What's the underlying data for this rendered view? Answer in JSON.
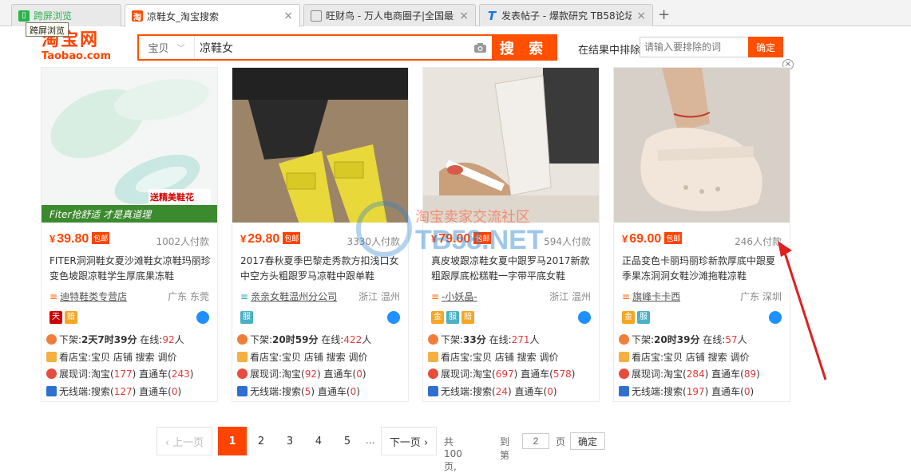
{
  "browser": {
    "tabs": [
      {
        "title": "跨屏浏览",
        "icon": "phone-icon",
        "icon_color": "#2bb24c"
      },
      {
        "title": "凉鞋女_淘宝搜索",
        "icon": "taobao-icon",
        "icon_color": "#ff5000",
        "close": "×"
      },
      {
        "title": "旺财鸟 - 万人电商圈子|全国最大",
        "icon": "document-icon",
        "icon_color": "#888888",
        "close": "×"
      },
      {
        "title": "发表帖子 - 爆款研究 TB58论坛",
        "icon": "t-icon",
        "icon_color": "#1a73e8",
        "close": "×"
      }
    ],
    "new_tab": "+",
    "tooltip": "跨屏浏览"
  },
  "header": {
    "logo_cn": "淘宝网",
    "logo_en": "Taobao.com",
    "search_type": "宝贝",
    "search_value": "凉鞋女",
    "search_button": "搜 索",
    "exclude_label": "在结果中排除",
    "exclude_placeholder": "请输入要排除的词",
    "exclude_button": "确定",
    "close": "×"
  },
  "products": [
    {
      "price": "39.80",
      "currency": "¥",
      "baoyou": "包邮",
      "sales": "1002人付款",
      "title": "FITER洞洞鞋女夏沙滩鞋女凉鞋玛丽珍变色坡跟凉鞋学生厚底果冻鞋",
      "shop": "迪特鞋类专营店",
      "location": "广东 东莞",
      "image_caption_top": "送精美鞋花",
      "image_caption_bottom": "Fiter抢舒适 才是真道理",
      "badges": [
        {
          "text": "天",
          "color": "#cc0000"
        },
        {
          "text": "赔",
          "color": "#f5a623"
        }
      ],
      "offline": "下架:",
      "offline_time": "2天7时39分",
      "online_label": "在线:",
      "online": "92",
      "online_unit": "人",
      "store_tools": "看店宝:宝贝 店铺 搜索 调价",
      "show_label": "展现词:淘宝(",
      "show_count": "177",
      "show_mid": ") 直通车(",
      "show_ztc": "243",
      "show_end": ")",
      "wireless_label": "无线端:搜索(",
      "wireless_count": "127",
      "wireless_mid": ") 直通车(",
      "wireless_ztc": "0",
      "wireless_end": ")"
    },
    {
      "price": "29.80",
      "currency": "¥",
      "baoyou": "包邮",
      "sales": "3330人付款",
      "title": "2017春秋夏季巴黎走秀款方扣浅口女中空方头粗跟罗马凉鞋中跟单鞋",
      "shop": "亲亲女鞋温州分公司",
      "location": "浙江 温州",
      "badges": [
        {
          "text": "服",
          "color": "#4ab0c5"
        }
      ],
      "offline": "下架:",
      "offline_time": "20时59分",
      "online_label": "在线:",
      "online": "422",
      "online_unit": "人",
      "store_tools": "看店宝:宝贝 店铺 搜索 调价",
      "show_label": "展现词:淘宝(",
      "show_count": "92",
      "show_mid": ") 直通车(",
      "show_ztc": "0",
      "show_end": ")",
      "wireless_label": "无线端:搜索(",
      "wireless_count": "5",
      "wireless_mid": ") 直通车(",
      "wireless_ztc": "0",
      "wireless_end": ")"
    },
    {
      "price": "79.00",
      "currency": "¥",
      "baoyou": "包邮",
      "sales": "594人付款",
      "title": "真皮坡跟凉鞋女夏中跟罗马2017新款粗跟厚底松糕鞋一字带平底女鞋",
      "shop": "-小妖晶-",
      "location": "浙江 温州",
      "badges": [
        {
          "text": "金",
          "color": "#f5a623"
        },
        {
          "text": "服",
          "color": "#4ab0c5"
        },
        {
          "text": "赔",
          "color": "#f5a623"
        }
      ],
      "offline": "下架:",
      "offline_time": "33分",
      "online_label": "在线:",
      "online": "271",
      "online_unit": "人",
      "store_tools": "看店宝:宝贝 店铺 搜索 调价",
      "show_label": "展现词:淘宝(",
      "show_count": "697",
      "show_mid": ") 直通车(",
      "show_ztc": "578",
      "show_end": ")",
      "wireless_label": "无线端:搜索(",
      "wireless_count": "24",
      "wireless_mid": ") 直通车(",
      "wireless_ztc": "0",
      "wireless_end": ")"
    },
    {
      "price": "69.00",
      "currency": "¥",
      "baoyou": "包邮",
      "sales": "246人付款",
      "title": "正品变色卡丽玛丽珍新款厚底中跟夏季果冻洞洞女鞋沙滩拖鞋凉鞋",
      "shop": "旗峰卡卡西",
      "location": "广东 深圳",
      "badges": [
        {
          "text": "金",
          "color": "#f5a623"
        },
        {
          "text": "服",
          "color": "#4ab0c5"
        }
      ],
      "offline": "下架:",
      "offline_time": "20时39分",
      "online_label": "在线:",
      "online": "57",
      "online_unit": "人",
      "store_tools": "看店宝:宝贝 店铺 搜索 调价",
      "show_label": "展现词:淘宝(",
      "show_count": "284",
      "show_mid": ") 直通车(",
      "show_ztc": "89",
      "show_end": ")",
      "wireless_label": "无线端:搜索(",
      "wireless_count": "197",
      "wireless_mid": ") 直通车(",
      "wireless_ztc": "0",
      "wireless_end": ")"
    }
  ],
  "watermark": {
    "cn": "淘宝卖家交流社区",
    "en": "TB58.NET"
  },
  "pagination": {
    "prev": "‹ 上一页",
    "pages": [
      "1",
      "2",
      "3",
      "4",
      "5"
    ],
    "ellipsis": "...",
    "next": "下一页 ›",
    "total": "共 100 页,",
    "goto": "到第",
    "goto_value": "2",
    "page_unit": "页",
    "confirm": "确定"
  },
  "colors": {
    "accent": "#ff5000",
    "price": "#ff4400"
  }
}
